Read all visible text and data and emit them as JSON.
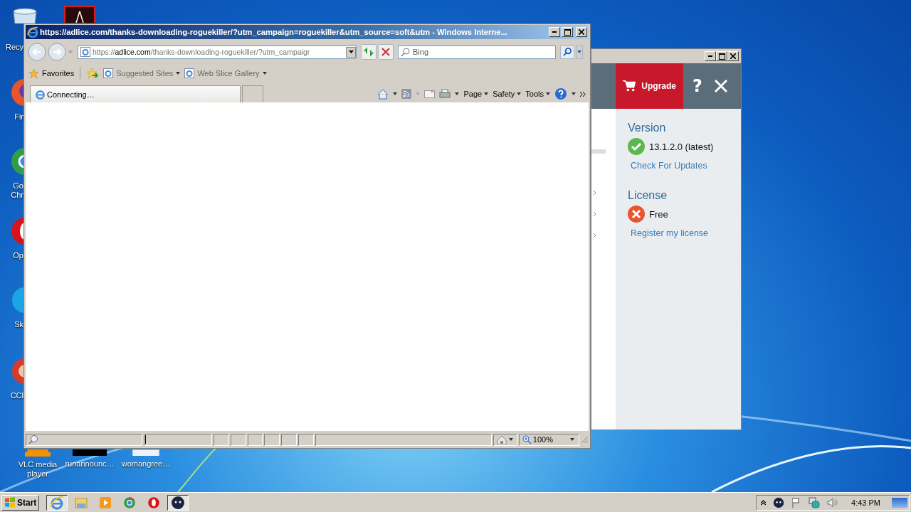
{
  "desktop": {
    "icons": [
      {
        "kind": "recycle",
        "label": "Recy"
      },
      {
        "kind": "firefox",
        "label": "Fir"
      },
      {
        "kind": "chrome",
        "label": "Go\nChr"
      },
      {
        "kind": "opera",
        "label": "Op"
      },
      {
        "kind": "skype",
        "label": "Sk"
      },
      {
        "kind": "ccleaner",
        "label": "CCl"
      },
      {
        "kind": "vlc",
        "label": "VLC media\nplayer"
      },
      {
        "kind": "acrobat"
      },
      {
        "kind": "black-file",
        "label": "runannounc…"
      },
      {
        "kind": "doc-file",
        "label": "womangree…"
      }
    ]
  },
  "browser": {
    "title": "https://adlice.com/thanks-downloading-roguekiller/?utm_campaign=roguekiller&utm_source=soft&utm - Windows Interne...",
    "address": {
      "scheme": "https://",
      "host": "adlice.com",
      "path": "/thanks-downloading-roguekiller/?utm_campaigr"
    },
    "search": {
      "placeholder": "Bing"
    },
    "favorites": [
      {
        "kind": "star",
        "label": "Favorites"
      },
      {
        "kind": "add"
      },
      {
        "kind": "site",
        "label": "Suggested Sites"
      },
      {
        "kind": "site",
        "label": "Web Slice Gallery"
      }
    ],
    "tabs": [
      {
        "label": "Connecting…",
        "selected": true
      }
    ],
    "commands": [
      {
        "label": "Page"
      },
      {
        "label": "Safety"
      },
      {
        "label": "Tools"
      }
    ],
    "zoom": "100%"
  },
  "roguekiller": {
    "upgrade": "Upgrade",
    "help": "?",
    "sections": [
      {
        "heading": "Version",
        "kind": "ok",
        "value": "13.1.2.0 (latest)",
        "link": "Check For Updates"
      },
      {
        "heading": "License",
        "kind": "error",
        "value": "Free",
        "link": "Register my license"
      }
    ]
  },
  "taskbar": {
    "start": "Start",
    "apps": [
      {
        "kind": "ie",
        "selected": true
      },
      {
        "kind": "explorer",
        "selected": false
      },
      {
        "kind": "media",
        "selected": false
      },
      {
        "kind": "chrome",
        "selected": false
      },
      {
        "kind": "opera",
        "selected": false
      },
      {
        "kind": "roguekiller",
        "selected": true
      }
    ],
    "time": "4:43 PM"
  }
}
